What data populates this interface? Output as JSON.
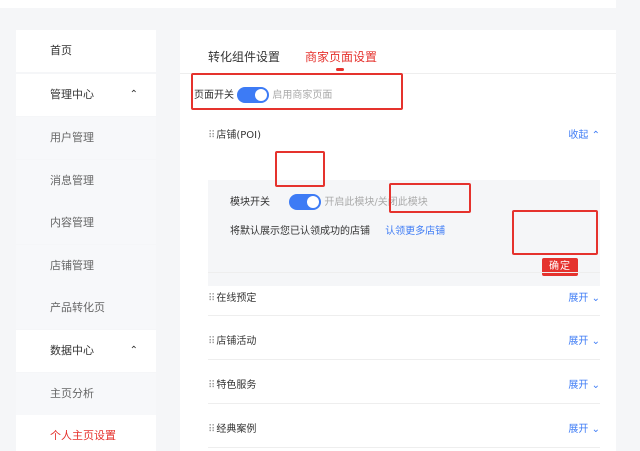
{
  "sidebar": {
    "items": [
      {
        "label": "首页"
      },
      {
        "label": "管理中心",
        "caret": "⌃"
      },
      {
        "label": "用户管理"
      },
      {
        "label": "消息管理"
      },
      {
        "label": "内容管理"
      },
      {
        "label": "店铺管理"
      },
      {
        "label": "产品转化页"
      },
      {
        "label": "数据中心",
        "caret": "⌃"
      },
      {
        "label": "主页分析"
      },
      {
        "label": "个人主页设置"
      }
    ]
  },
  "tabs": [
    {
      "label": "转化组件设置"
    },
    {
      "label": "商家页面设置"
    }
  ],
  "page_switch": {
    "label": "页面开关",
    "hint": "启用商家页面",
    "enabled": true
  },
  "poi_section": {
    "title": "店铺(POI)",
    "action": "收起",
    "action_icon": "chevron-up-icon",
    "module_switch_label": "模块开关",
    "module_switch_hint": "开启此模块/关闭此模块",
    "module_enabled": true,
    "desc": "将默认展示您已认领成功的店铺",
    "link": "认领更多店铺",
    "confirm": "确定"
  },
  "sections": [
    {
      "title": "在线预定",
      "action": "展开"
    },
    {
      "title": "店铺活动",
      "action": "展开"
    },
    {
      "title": "特色服务",
      "action": "展开"
    },
    {
      "title": "经典案例",
      "action": "展开"
    }
  ],
  "colors": {
    "accent": "#e5322d",
    "link": "#3d7bf5"
  }
}
